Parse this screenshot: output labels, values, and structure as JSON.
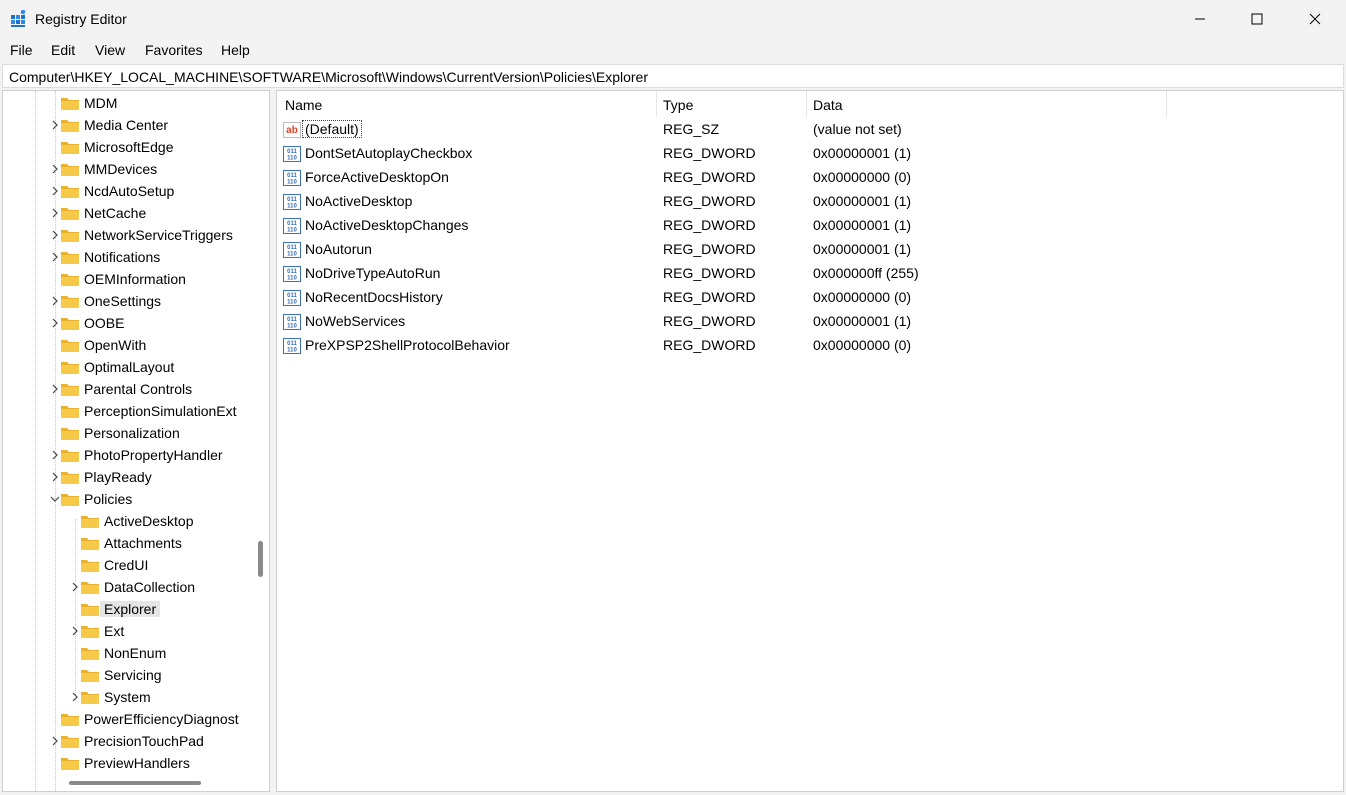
{
  "window": {
    "title": "Registry Editor"
  },
  "menu": [
    "File",
    "Edit",
    "View",
    "Favorites",
    "Help"
  ],
  "address": "Computer\\HKEY_LOCAL_MACHINE\\SOFTWARE\\Microsoft\\Windows\\CurrentVersion\\Policies\\Explorer",
  "tree": [
    {
      "label": "MDM",
      "level": 1,
      "expander": "none"
    },
    {
      "label": "Media Center",
      "level": 1,
      "expander": "collapsed"
    },
    {
      "label": "MicrosoftEdge",
      "level": 1,
      "expander": "none"
    },
    {
      "label": "MMDevices",
      "level": 1,
      "expander": "collapsed"
    },
    {
      "label": "NcdAutoSetup",
      "level": 1,
      "expander": "collapsed"
    },
    {
      "label": "NetCache",
      "level": 1,
      "expander": "collapsed"
    },
    {
      "label": "NetworkServiceTriggers",
      "level": 1,
      "expander": "collapsed"
    },
    {
      "label": "Notifications",
      "level": 1,
      "expander": "collapsed"
    },
    {
      "label": "OEMInformation",
      "level": 1,
      "expander": "none"
    },
    {
      "label": "OneSettings",
      "level": 1,
      "expander": "collapsed"
    },
    {
      "label": "OOBE",
      "level": 1,
      "expander": "collapsed"
    },
    {
      "label": "OpenWith",
      "level": 1,
      "expander": "none"
    },
    {
      "label": "OptimalLayout",
      "level": 1,
      "expander": "none"
    },
    {
      "label": "Parental Controls",
      "level": 1,
      "expander": "collapsed"
    },
    {
      "label": "PerceptionSimulationExt",
      "level": 1,
      "expander": "none"
    },
    {
      "label": "Personalization",
      "level": 1,
      "expander": "none"
    },
    {
      "label": "PhotoPropertyHandler",
      "level": 1,
      "expander": "collapsed"
    },
    {
      "label": "PlayReady",
      "level": 1,
      "expander": "collapsed"
    },
    {
      "label": "Policies",
      "level": 1,
      "expander": "expanded"
    },
    {
      "label": "ActiveDesktop",
      "level": 2,
      "expander": "none"
    },
    {
      "label": "Attachments",
      "level": 2,
      "expander": "none"
    },
    {
      "label": "CredUI",
      "level": 2,
      "expander": "none"
    },
    {
      "label": "DataCollection",
      "level": 2,
      "expander": "collapsed"
    },
    {
      "label": "Explorer",
      "level": 2,
      "expander": "none",
      "selected": true
    },
    {
      "label": "Ext",
      "level": 2,
      "expander": "collapsed"
    },
    {
      "label": "NonEnum",
      "level": 2,
      "expander": "none"
    },
    {
      "label": "Servicing",
      "level": 2,
      "expander": "none"
    },
    {
      "label": "System",
      "level": 2,
      "expander": "collapsed"
    },
    {
      "label": "PowerEfficiencyDiagnost",
      "level": 1,
      "expander": "none"
    },
    {
      "label": "PrecisionTouchPad",
      "level": 1,
      "expander": "collapsed"
    },
    {
      "label": "PreviewHandlers",
      "level": 1,
      "expander": "none"
    }
  ],
  "columns": {
    "name": "Name",
    "type": "Type",
    "data": "Data"
  },
  "values": [
    {
      "name": "(Default)",
      "type": "REG_SZ",
      "data": "(value not set)",
      "icon": "string-value-icon"
    },
    {
      "name": "DontSetAutoplayCheckbox",
      "type": "REG_DWORD",
      "data": "0x00000001 (1)",
      "icon": "binary-value-icon"
    },
    {
      "name": "ForceActiveDesktopOn",
      "type": "REG_DWORD",
      "data": "0x00000000 (0)",
      "icon": "binary-value-icon"
    },
    {
      "name": "NoActiveDesktop",
      "type": "REG_DWORD",
      "data": "0x00000001 (1)",
      "icon": "binary-value-icon"
    },
    {
      "name": "NoActiveDesktopChanges",
      "type": "REG_DWORD",
      "data": "0x00000001 (1)",
      "icon": "binary-value-icon"
    },
    {
      "name": "NoAutorun",
      "type": "REG_DWORD",
      "data": "0x00000001 (1)",
      "icon": "binary-value-icon"
    },
    {
      "name": "NoDriveTypeAutoRun",
      "type": "REG_DWORD",
      "data": "0x000000ff (255)",
      "icon": "binary-value-icon"
    },
    {
      "name": "NoRecentDocsHistory",
      "type": "REG_DWORD",
      "data": "0x00000000 (0)",
      "icon": "binary-value-icon"
    },
    {
      "name": "NoWebServices",
      "type": "REG_DWORD",
      "data": "0x00000001 (1)",
      "icon": "binary-value-icon"
    },
    {
      "name": "PreXPSP2ShellProtocolBehavior",
      "type": "REG_DWORD",
      "data": "0x00000000 (0)",
      "icon": "binary-value-icon"
    }
  ],
  "colors": {
    "folder": "#f7c948",
    "folder_dark": "#e8b22e",
    "selection": "#e5e5e5",
    "string_icon": "#d9472b",
    "binary_icon": "#3c6eb4"
  }
}
